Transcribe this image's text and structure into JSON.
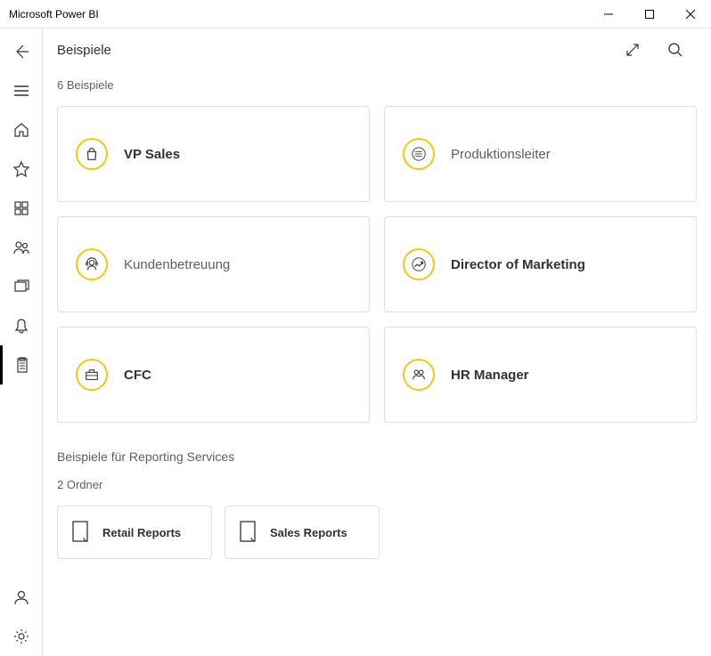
{
  "window": {
    "title": "Microsoft Power BI"
  },
  "header": {
    "title": "Beispiele"
  },
  "samples": {
    "count_label": "6 Beispiele",
    "items": [
      {
        "label": "VP Sales",
        "style": "bold"
      },
      {
        "label": "Produktionsleiter",
        "style": "light"
      },
      {
        "label": "Kundenbetreuung",
        "style": "light"
      },
      {
        "label": "Director of Marketing",
        "style": "bold"
      },
      {
        "label": "CFC",
        "style": "bold"
      },
      {
        "label": "HR Manager",
        "style": "bold"
      }
    ]
  },
  "reporting": {
    "title": "Beispiele für Reporting Services",
    "count_label": "2 Ordner",
    "folders": [
      {
        "label": "Retail Reports"
      },
      {
        "label": "Sales Reports"
      }
    ]
  }
}
